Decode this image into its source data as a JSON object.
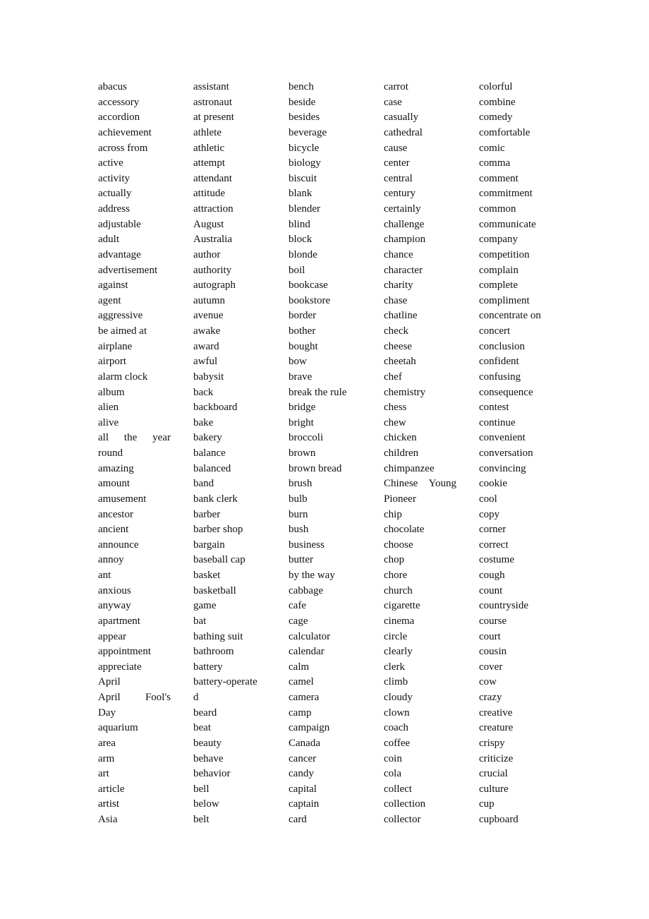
{
  "document": {
    "columns": [
      {
        "name": "column-1",
        "lines": [
          "abacus",
          "accessory",
          "accordion",
          "achievement",
          "across from",
          "active",
          "activity",
          "actually",
          "address",
          "adjustable",
          "adult",
          "advantage",
          "advertisement",
          "against",
          "agent",
          "aggressive",
          "be aimed at",
          "airplane",
          "airport",
          "alarm clock",
          "album",
          "alien",
          "alive",
          "all the year",
          "round",
          "amazing",
          "amount",
          "amusement",
          "ancestor",
          "ancient",
          "announce",
          "annoy",
          "ant",
          "anxious",
          "anyway",
          "apartment",
          "appear",
          "appointment",
          "appreciate",
          "April",
          "April Fool's",
          "Day",
          "aquarium",
          "area",
          "arm",
          "art",
          "article",
          "artist",
          "Asia"
        ]
      },
      {
        "name": "column-2",
        "lines": [
          "assistant",
          "astronaut",
          "at present",
          "athlete",
          "athletic",
          "attempt",
          "attendant",
          "attitude",
          "attraction",
          "August",
          "Australia",
          "author",
          "authority",
          "autograph",
          "autumn",
          "avenue",
          "awake",
          "award",
          "awful",
          "babysit",
          "back",
          "backboard",
          "bake",
          "bakery",
          "balance",
          "balanced",
          "band",
          "bank clerk",
          "barber",
          "barber shop",
          "bargain",
          "baseball cap",
          "basket",
          "basketball",
          "game",
          "bat",
          "bathing suit",
          "bathroom",
          "battery",
          "battery-operate",
          "d",
          "beard",
          "beat",
          "beauty",
          "behave",
          "behavior",
          "bell",
          "below",
          "belt"
        ]
      },
      {
        "name": "column-3",
        "lines": [
          "bench",
          "beside",
          "besides",
          "beverage",
          "bicycle",
          "biology",
          "biscuit",
          "blank",
          "blender",
          "blind",
          "block",
          "blonde",
          "boil",
          "bookcase",
          "bookstore",
          "border",
          "bother",
          "bought",
          "bow",
          "brave",
          "break the rule",
          "bridge",
          "bright",
          "broccoli",
          "brown",
          "brown bread",
          "brush",
          "bulb",
          "burn",
          "bush",
          "business",
          "butter",
          "by the way",
          "cabbage",
          "cafe",
          "cage",
          "calculator",
          "calendar",
          "calm",
          "camel",
          "camera",
          "camp",
          "campaign",
          "Canada",
          "cancer",
          "candy",
          "capital",
          "captain",
          "card"
        ]
      },
      {
        "name": "column-4",
        "lines": [
          "carrot",
          "case",
          "casually",
          "cathedral",
          "cause",
          "center",
          "central",
          "century",
          "certainly",
          "challenge",
          "champion",
          "chance",
          "character",
          "charity",
          "chase",
          "chatline",
          "check",
          "cheese",
          "cheetah",
          "chef",
          "chemistry",
          "chess",
          "chew",
          "chicken",
          "children",
          "chimpanzee",
          "Chinese Young",
          "Pioneer",
          "chip",
          "chocolate",
          "choose",
          "chop",
          "chore",
          "church",
          "cigarette",
          "cinema",
          "circle",
          "clearly",
          "clerk",
          "climb",
          "cloudy",
          "clown",
          "coach",
          "coffee",
          "coin",
          "cola",
          "collect",
          "collection",
          "collector"
        ]
      },
      {
        "name": "column-5",
        "lines": [
          "colorful",
          "combine",
          "comedy",
          "comfortable",
          "comic",
          "comma",
          "comment",
          "commitment",
          "common",
          "communicate",
          "company",
          "competition",
          "complain",
          "complete",
          "compliment",
          "concentrate on",
          "concert",
          "conclusion",
          "confident",
          "confusing",
          "consequence",
          "contest",
          "continue",
          "convenient",
          "conversation",
          "convincing",
          "cookie",
          "cool",
          "copy",
          "corner",
          "correct",
          "costume",
          "cough",
          "count",
          "countryside",
          "course",
          "court",
          "cousin",
          "cover",
          "cow",
          "crazy",
          "creative",
          "creature",
          "crispy",
          "criticize",
          "crucial",
          "culture",
          "cup",
          "cupboard"
        ]
      }
    ],
    "justified_lines": [
      "all the year",
      "April Fool's",
      "Chinese Young"
    ]
  }
}
